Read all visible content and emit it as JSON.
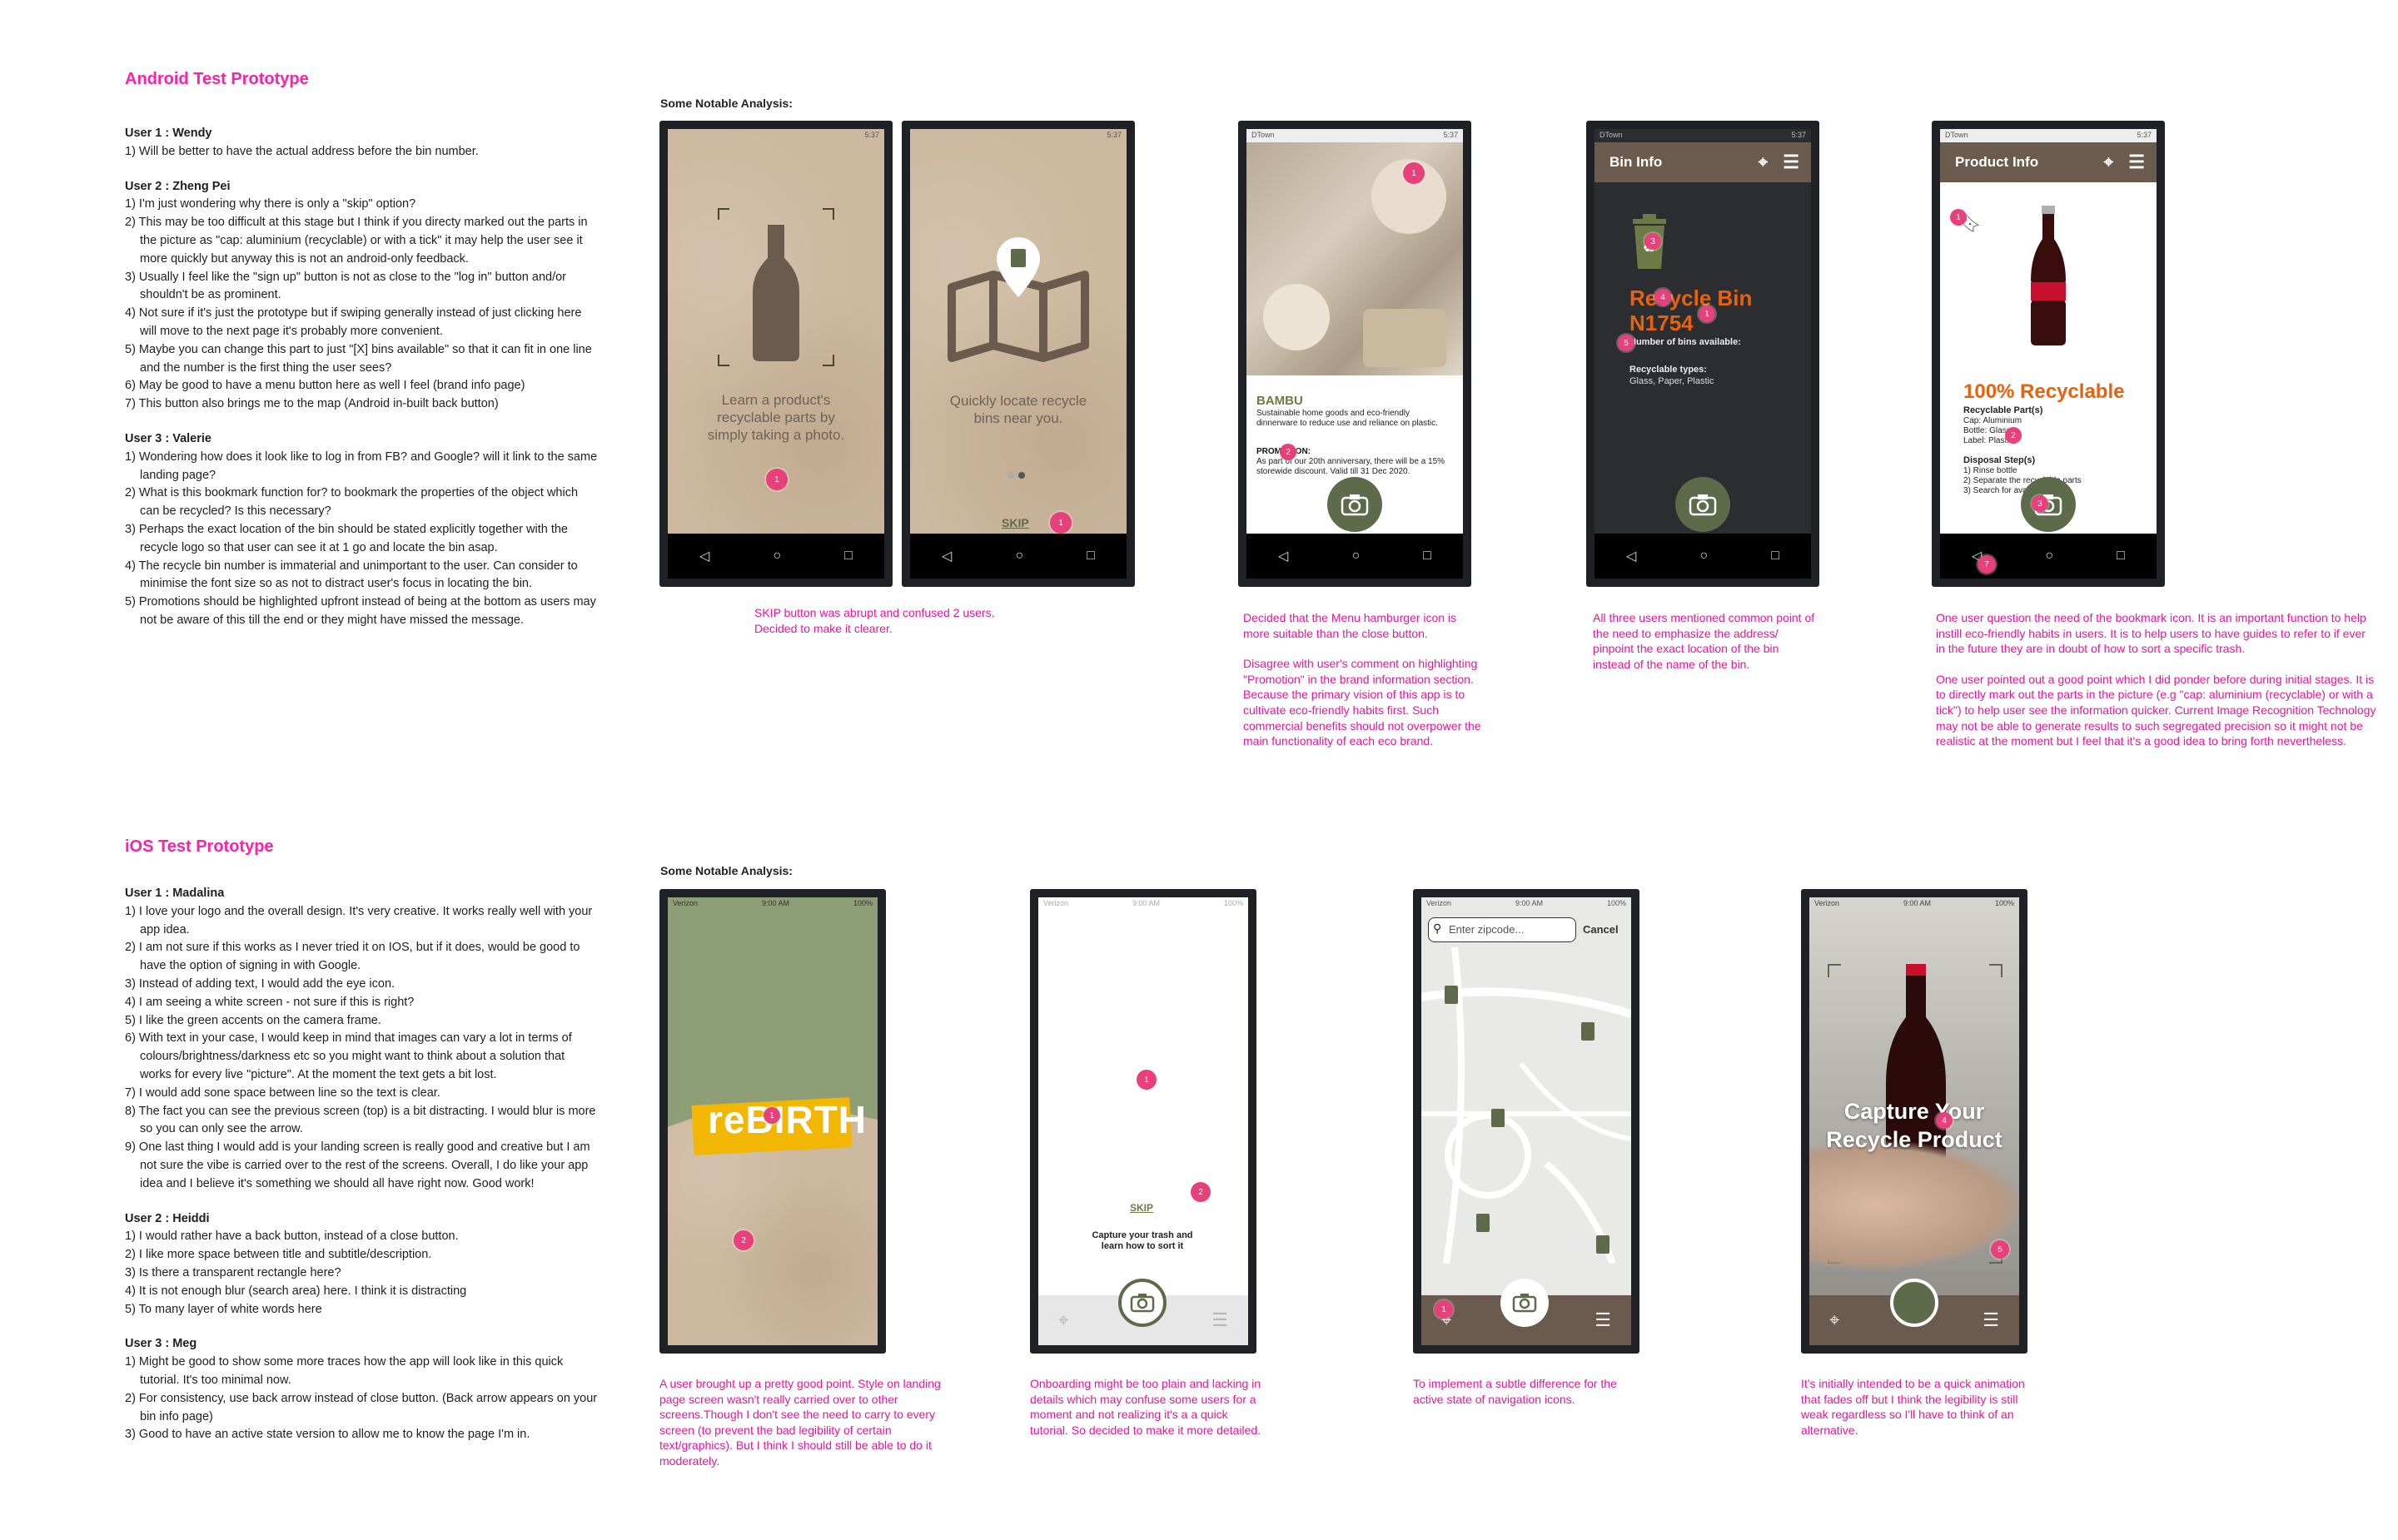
{
  "android": {
    "title": "Android Test Prototype",
    "users": [
      {
        "name": "User 1 : Wendy",
        "items": [
          "1) Will be better to have the actual address before the bin number."
        ]
      },
      {
        "name": "User 2 : Zheng Pei",
        "items": [
          "1) I'm just wondering why there is only a \"skip\" option?",
          "2) This may be too difficult at this stage but I think if you directy marked out the parts in the picture as \"cap: aluminium (recyclable) or with a tick\" it may help the user see it more quickly but anyway this is not an android-only feedback.",
          "3) Usually I feel like the \"sign up\" button is not as close to the \"log in\" button and/or shouldn't be as prominent.",
          "4) Not sure if it's just the prototype but if swiping generally instead of just clicking here will move to the next page it's probably more convenient.",
          "5) Maybe you can change this part to just \"[X] bins available\" so that it can fit in one line and the number is the first thing the user sees?",
          "6) May be good to have a menu button here as well I feel (brand info page)",
          "7) This button also brings me to the map (Android in-built back button)"
        ]
      },
      {
        "name": "User 3 : Valerie",
        "items": [
          "1) Wondering how does it look like to log in from FB? and Google? will it link to the same landing page?",
          "2) What is this bookmark function for? to bookmark the properties of the object which can be recycled? Is this necessary?",
          "3) Perhaps the exact location of the bin should be stated explicitly together with the recycle logo so that user can see it at 1 go and locate the bin asap.",
          "4) The recycle bin number is immaterial and unimportant to the user. Can consider to minimise the font size so as not to distract user's focus in locating the bin.",
          "5) Promotions should be highlighted upfront instead of being at the bottom as users may not be aware of this till the end or they might have missed the message."
        ]
      }
    ],
    "analysis_title": "Some Notable Analysis:",
    "screens": {
      "s1_text": "Learn a product's recyclable parts by simply taking a photo.",
      "s2_text": "Quickly locate recycle bins near you.",
      "s2_skip": "SKIP",
      "s3_brand": "BAMBU",
      "s3_desc": "Sustainable home goods and eco-friendly dinnerware to reduce use and reliance on plastic.",
      "s3_promo_label": "PROMOTION:",
      "s3_promo_text": "As part of our 20th anniversary, there will be a 15% storewide discount. Valid till 31 Dec 2020.",
      "s4_header": "Bin Info",
      "s4_title1": "Recycle Bin",
      "s4_title2": "N1754",
      "s4_count": "Number of bins available:",
      "s4_types_label": "Recyclable types:",
      "s4_types": "Glass, Paper, Plastic",
      "s5_header": "Product Info",
      "s5_big": "100% Recyclable",
      "s5_parts_label": "Recyclable Part(s)",
      "s5_cap": "Cap: Aluminium",
      "s5_bottle": "Bottle: Glass",
      "s5_label": "Label: Plastic",
      "s5_steps_label": "Disposal Step(s)",
      "s5_step1": "1) Rinse bottle",
      "s5_step2": "2) Separate the recyclable parts",
      "s5_step3": "3) Search for available",
      "status_time": "5:37",
      "carrier": "DTown"
    },
    "notes": [
      "SKIP button was abrupt and confused 2 users. Decided to make it clearer.",
      "Decided that the Menu hamburger icon is more suitable than the close button.",
      "Disagree with user's comment on highlighting \"Promotion\" in the brand information section. Because the primary vision of this app is to cultivate eco-friendly habits first. Such commercial benefits should not overpower the main functionality of each eco brand.",
      "All three users mentioned common point of the need to emphasize the address/ pinpoint the exact location of the bin instead of the name of the bin.",
      "One user question the need of the bookmark icon. It is an important function to help instill eco-friendly habits in users. It is to help users to have guides to refer to if ever in the future they are in doubt of how to sort a specific trash.",
      "One user pointed out a good point which I did ponder before during initial stages. It is to directly mark out the parts in the picture (e.g \"cap: aluminium (recyclable) or with a tick\") to help user see the information quicker. Current Image Recognition Technology may not be able to generate results to such segregated precision so it might not be realistic at the moment but I feel that it's a good idea to bring forth nevertheless."
    ]
  },
  "ios": {
    "title": "iOS Test Prototype",
    "users": [
      {
        "name": "User 1 : Madalina",
        "items": [
          "1) I love your logo and the overall design. It's very creative. It works really well with your app idea.",
          "2) I am not sure if this works as I never tried it on IOS, but if it does, would be good to have the option of signing in with Google.",
          "3) Instead of adding text, I would add the eye icon.",
          "4) I am seeing a white screen - not sure if this is right?",
          "5) I like the green accents on the camera frame.",
          "6) With text in your case, I would keep in mind that images can vary a lot in terms of colours/brightness/darkness etc so you might want to think about a solution that works for every live \"picture\". At the moment the text gets a bit lost.",
          "7) I would add sone space between line so the text is clear.",
          "8) The fact you can see the previous screen (top) is a bit distracting. I would blur is more so you can only see the arrow.",
          "9) One last thing I would add is your landing screen is really good and creative but I am not sure the vibe is carried over to the rest of the screens. Overall, I do like your app idea and I believe it's something we should all have right now. Good work!"
        ]
      },
      {
        "name": "User 2 : Heiddi",
        "items": [
          "1) I would rather have a back button, instead of a close button.",
          "2) I like more space between title and subtitle/description.",
          "3) Is there a transparent rectangle here?",
          "4) It is not enough blur (search area) here. I think it is distracting",
          "5) To many layer of white words here"
        ]
      },
      {
        "name": "User 3 : Meg",
        "items": [
          "1) Might be good to show some more traces how the app will look like in this quick tutorial. It's too minimal now.",
          "2) For consistency, use back arrow instead of close button. (Back arrow appears on your bin info page)",
          "3) Good to have an active state version to allow me to know the page I'm in."
        ]
      }
    ],
    "analysis_title": "Some Notable Analysis:",
    "screens": {
      "logo": "reBIRTH",
      "skip": "SKIP",
      "capture_text": "Capture your trash and learn how to sort it",
      "search_placeholder": "Enter zipcode...",
      "cancel": "Cancel",
      "overlay_text": "Capture Your Recycle Product",
      "ios_carrier": "Verizon",
      "ios_time": "9:00 AM",
      "ios_battery": "100%"
    },
    "notes": [
      "A user brought up a pretty good point. Style on landing page screen wasn't really carried over to other screens.Though I don't see the need to carry to every screen (to prevent the bad legibility of certain text/graphics). But I think I should still be able to do it moderately.",
      "Onboarding might be too plain and lacking in details which may confuse some users for a moment and not realizing it's a a quick tutorial. So decided to make it more detailed.",
      "To implement a subtle difference for the active state of navigation icons.",
      "It's initially intended to be a quick animation that fades off but I think the legibility is still weak regardless so I'll have to think of an alternative."
    ]
  },
  "colors": {
    "accent": "#ff1fa8",
    "note": "#e6189a",
    "olive": "#5e6b4b",
    "brown": "#6a5b4e",
    "orange": "#e8620c",
    "kraft": "#cdb9a0"
  }
}
